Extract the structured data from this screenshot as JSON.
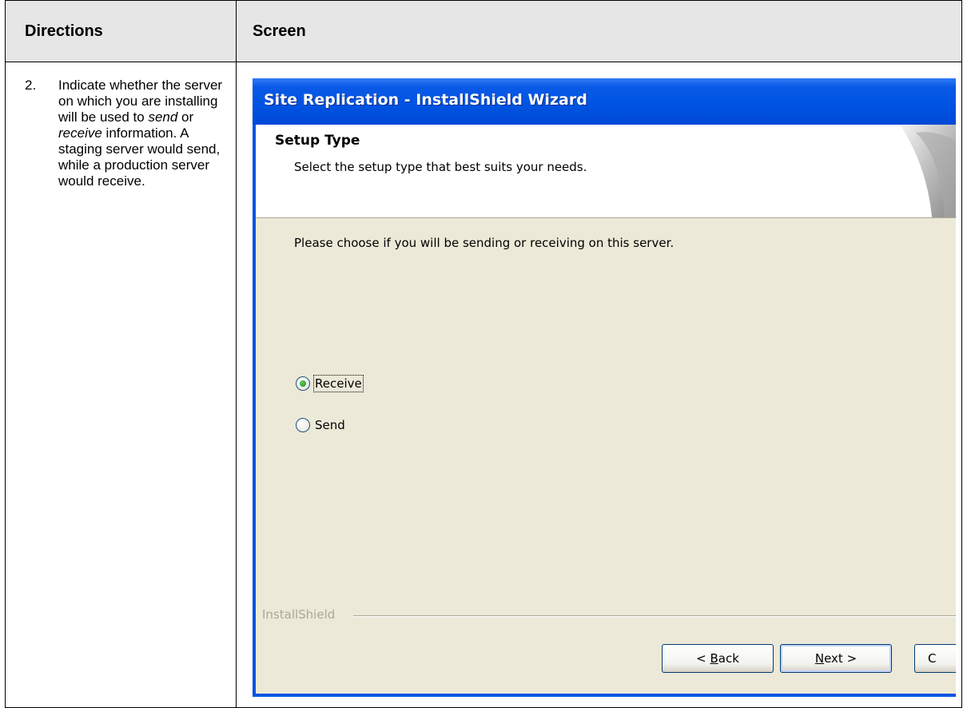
{
  "table": {
    "header_directions": "Directions",
    "header_screen": "Screen"
  },
  "step": {
    "number": "2.",
    "text_parts": [
      "Indicate whether the server on which you are installing will be used to ",
      "send",
      " or ",
      "receive",
      " information. A staging server would send, while a production server would receive."
    ]
  },
  "wizard": {
    "title": "Site Replication - InstallShield Wizard",
    "banner_title": "Setup Type",
    "banner_subtitle": "Select the setup type that best suits your needs.",
    "prompt": "Please choose if you will be sending or receiving on this server.",
    "options": [
      {
        "label": "Receive",
        "checked": true
      },
      {
        "label": "Send",
        "checked": false
      }
    ],
    "brand": "InstallShield",
    "buttons": {
      "back_prefix": "< ",
      "back_accel": "B",
      "back_rest": "ack",
      "next_accel": "N",
      "next_rest": "ext >",
      "cancel_partial": "C"
    }
  }
}
